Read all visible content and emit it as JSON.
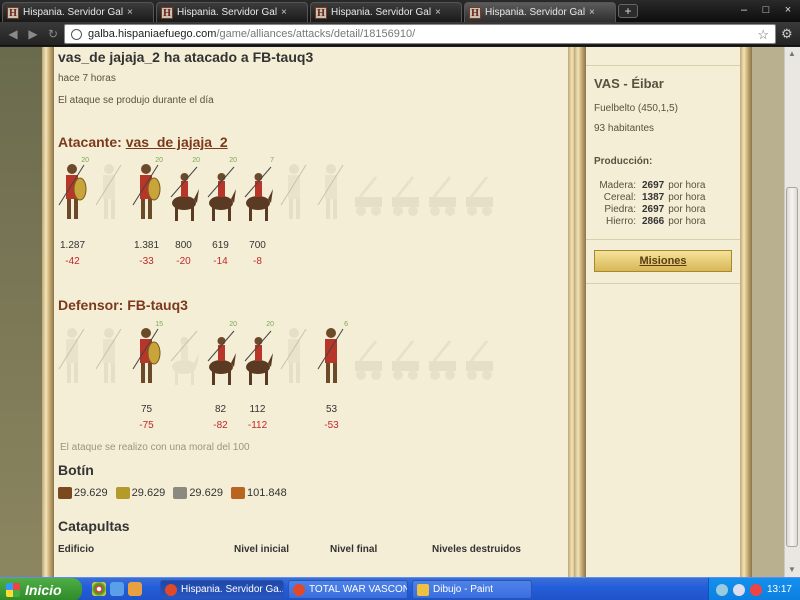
{
  "browser": {
    "tabs": [
      {
        "title": "Hispania. Servidor Galba",
        "close": "×"
      },
      {
        "title": "Hispania. Servidor Galba",
        "close": "×"
      },
      {
        "title": "Hispania. Servidor Galba",
        "close": "×"
      },
      {
        "title": "Hispania. Servidor Galba",
        "close": "×"
      }
    ],
    "favicon_letter": "H",
    "new_tab": "+",
    "window_controls": {
      "minimize": "–",
      "maximize": "□",
      "close": "×"
    },
    "url_host": "galba.hispaniaefuego.com",
    "url_path": "/game/alliances/attacks/detail/18156910/"
  },
  "report": {
    "title": "vas_de jajaja_2 ha atacado a FB-tauq3",
    "time_ago": "hace 7 horas",
    "timing": "El ataque se produjo durante el día",
    "attacker_label": "Atacante:",
    "attacker_name": "vas_de jajaja_2",
    "attacker_units": [
      {
        "icon": "infantry-shield-icon",
        "level": "20",
        "count": "1.287",
        "loss": "-42",
        "active": true
      },
      {
        "icon": "slinger-icon",
        "level": "",
        "count": "",
        "loss": "",
        "active": false
      },
      {
        "icon": "legionary-icon",
        "level": "20",
        "count": "1.381",
        "loss": "-33",
        "active": true
      },
      {
        "icon": "cavalry-spear-icon",
        "level": "20",
        "count": "800",
        "loss": "-20",
        "active": true
      },
      {
        "icon": "cavalry-gold-icon",
        "level": "20",
        "count": "619",
        "loss": "-14",
        "active": true
      },
      {
        "icon": "cavalry-red-icon",
        "level": "7",
        "count": "700",
        "loss": "-8",
        "active": true
      },
      {
        "icon": "scout-icon",
        "level": "",
        "count": "",
        "loss": "",
        "active": false
      },
      {
        "icon": "archer-icon",
        "level": "",
        "count": "",
        "loss": "",
        "active": false
      },
      {
        "icon": "ram-icon",
        "level": "",
        "count": "",
        "loss": "",
        "active": false
      },
      {
        "icon": "catapult-icon",
        "level": "",
        "count": "",
        "loss": "",
        "active": false
      },
      {
        "icon": "oxen-icon",
        "level": "",
        "count": "",
        "loss": "",
        "active": false
      },
      {
        "icon": "wagon-icon",
        "level": "",
        "count": "",
        "loss": "",
        "active": false
      }
    ],
    "defender_label": "Defensor:",
    "defender_name": "FB-tauq3",
    "defender_units": [
      {
        "icon": "infantry-axe-icon",
        "level": "",
        "count": "",
        "loss": "",
        "active": false
      },
      {
        "icon": "slinger-icon",
        "level": "",
        "count": "",
        "loss": "",
        "active": false
      },
      {
        "icon": "legionary-icon",
        "level": "15",
        "count": "75",
        "loss": "-75",
        "active": true
      },
      {
        "icon": "cavalry-ghost-icon",
        "level": "",
        "count": "",
        "loss": "",
        "active": false
      },
      {
        "icon": "cavalry-dark-icon",
        "level": "20",
        "count": "82",
        "loss": "-82",
        "active": true
      },
      {
        "icon": "cavalry-red-icon",
        "level": "20",
        "count": "112",
        "loss": "-112",
        "active": true
      },
      {
        "icon": "scout-icon",
        "level": "",
        "count": "",
        "loss": "",
        "active": false
      },
      {
        "icon": "spearman-icon",
        "level": "6",
        "count": "53",
        "loss": "-53",
        "active": true
      },
      {
        "icon": "ram-icon",
        "level": "",
        "count": "",
        "loss": "",
        "active": false
      },
      {
        "icon": "catapult-icon",
        "level": "",
        "count": "",
        "loss": "",
        "active": false
      },
      {
        "icon": "oxen-icon",
        "level": "",
        "count": "",
        "loss": "",
        "active": false
      },
      {
        "icon": "wagon-icon",
        "level": "",
        "count": "",
        "loss": "",
        "active": false
      }
    ],
    "morale_note": "El ataque se realizo con una moral del 100",
    "loot_title": "Botín",
    "loot": [
      {
        "icon": "wood-icon",
        "value": "29.629",
        "color": "#7a4a1e"
      },
      {
        "icon": "wheat-icon",
        "value": "29.629",
        "color": "#b49a2a"
      },
      {
        "icon": "stone-icon",
        "value": "29.629",
        "color": "#8a8a80"
      },
      {
        "icon": "iron-icon",
        "value": "101.848",
        "color": "#b9651f"
      }
    ],
    "catapults_title": "Catapultas",
    "catapults_headers": [
      "Edificio",
      "Nivel inicial",
      "Nivel final",
      "Niveles destruidos"
    ]
  },
  "sidebar": {
    "village_name": "VAS - Éibar",
    "village_coords": "Fuelbelto (450,1,5)",
    "inhabitants": "93 habitantes",
    "production_title": "Producción:",
    "production": [
      {
        "resource": "Madera:",
        "value": "2697",
        "unit": "por hora"
      },
      {
        "resource": "Cereal:",
        "value": "1387",
        "unit": "por hora"
      },
      {
        "resource": "Piedra:",
        "value": "2697",
        "unit": "por hora"
      },
      {
        "resource": "Hierro:",
        "value": "2866",
        "unit": "por hora"
      }
    ],
    "missions_button": "Misiones"
  },
  "taskbar": {
    "start_label": "Inicio",
    "tasks": [
      {
        "label": "Hispania. Servidor Ga...",
        "icon_color": "#e04a2a"
      },
      {
        "label": "TOTAL WAR VASCON...",
        "icon_color": "#e04a2a"
      },
      {
        "label": "Dibujo - Paint",
        "icon_color": "#f0c040"
      }
    ],
    "clock": "13:17"
  },
  "colors": {
    "accent_brown": "#7b3a1c",
    "loss_red": "#c1272d",
    "panel_bg": "#f5eed6"
  }
}
